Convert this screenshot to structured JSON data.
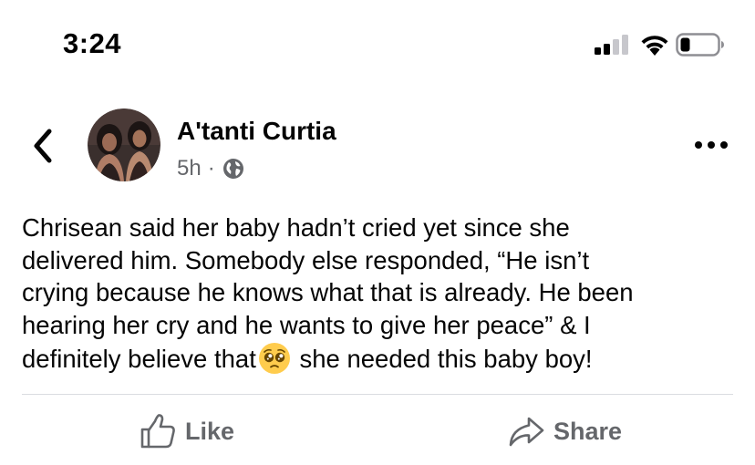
{
  "status_bar": {
    "time": "3:24",
    "icons": [
      "cellular-signal-icon",
      "wifi-icon",
      "battery-icon"
    ]
  },
  "post": {
    "author": "A'tanti Curtia",
    "time_ago": "5h",
    "separator": "·",
    "privacy_icon": "globe-icon",
    "text_lines": [
      "Chrisean said her baby hadn’t cried yet since she",
      "delivered him. Somebody else responded, “He isn’t",
      "crying because he knows what that is already. He been",
      "hearing her cry and he wants to give her peace” & I"
    ],
    "last_line_before_emoji": "definitely believe that",
    "emoji": "pleading-face-emoji",
    "last_line_after_emoji": "she needed this baby boy!"
  },
  "actions": {
    "like_label": "Like",
    "share_label": "Share"
  },
  "colors": {
    "text": "#050505",
    "secondary": "#65676b",
    "divider": "#dadde1"
  }
}
